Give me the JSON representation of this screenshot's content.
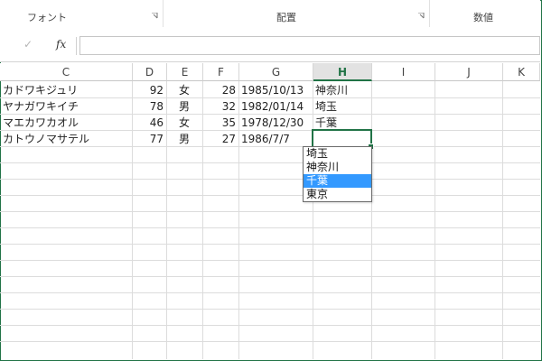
{
  "ribbon": {
    "groups": [
      {
        "label": "フォント"
      },
      {
        "label": "配置"
      },
      {
        "label": "数値"
      }
    ]
  },
  "formula_bar": {
    "enter_icon": "check-icon",
    "fx_label": "fx",
    "value": ""
  },
  "columns": [
    "C",
    "D",
    "E",
    "F",
    "G",
    "H",
    "I",
    "J",
    "K"
  ],
  "active_column": "H",
  "rows": [
    {
      "c": "カドワキジュリ",
      "d": "92",
      "e": "女",
      "f": "28",
      "g": "1985/10/13",
      "h": "神奈川"
    },
    {
      "c": "ヤナガワキイチ",
      "d": "78",
      "e": "男",
      "f": "32",
      "g": "1982/01/14",
      "h": "埼玉"
    },
    {
      "c": "マエカワカオル",
      "d": "46",
      "e": "女",
      "f": "35",
      "g": "1978/12/30",
      "h": "千葉"
    },
    {
      "c": "カトウノマサテル",
      "d": "77",
      "e": "男",
      "f": "27",
      "g": "1986/7/7",
      "h": ""
    }
  ],
  "dropdown": {
    "options": [
      "埼玉",
      "神奈川",
      "千葉",
      "東京"
    ],
    "highlighted": "千葉"
  },
  "colors": {
    "accent": "#217346",
    "selection": "#3399ff"
  }
}
